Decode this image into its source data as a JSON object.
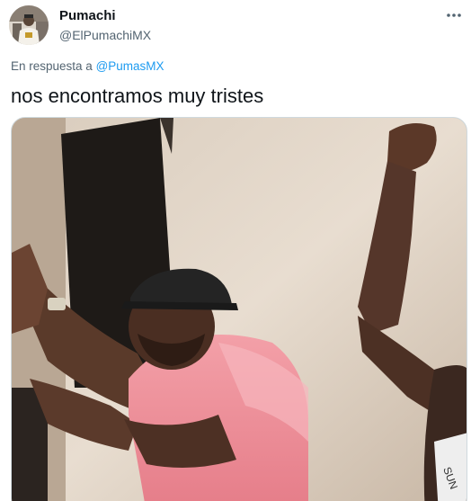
{
  "tweet": {
    "display_name": "Pumachi",
    "handle": "@ElPumachiMX",
    "reply_prefix": "En respuesta a",
    "reply_to": "@PumasMX",
    "text": "nos encontramos muy tristes",
    "more_icon": "more-horizontal-icon"
  },
  "colors": {
    "accent": "#1d9bf0",
    "text_primary": "#0f1419",
    "text_secondary": "#536471"
  }
}
